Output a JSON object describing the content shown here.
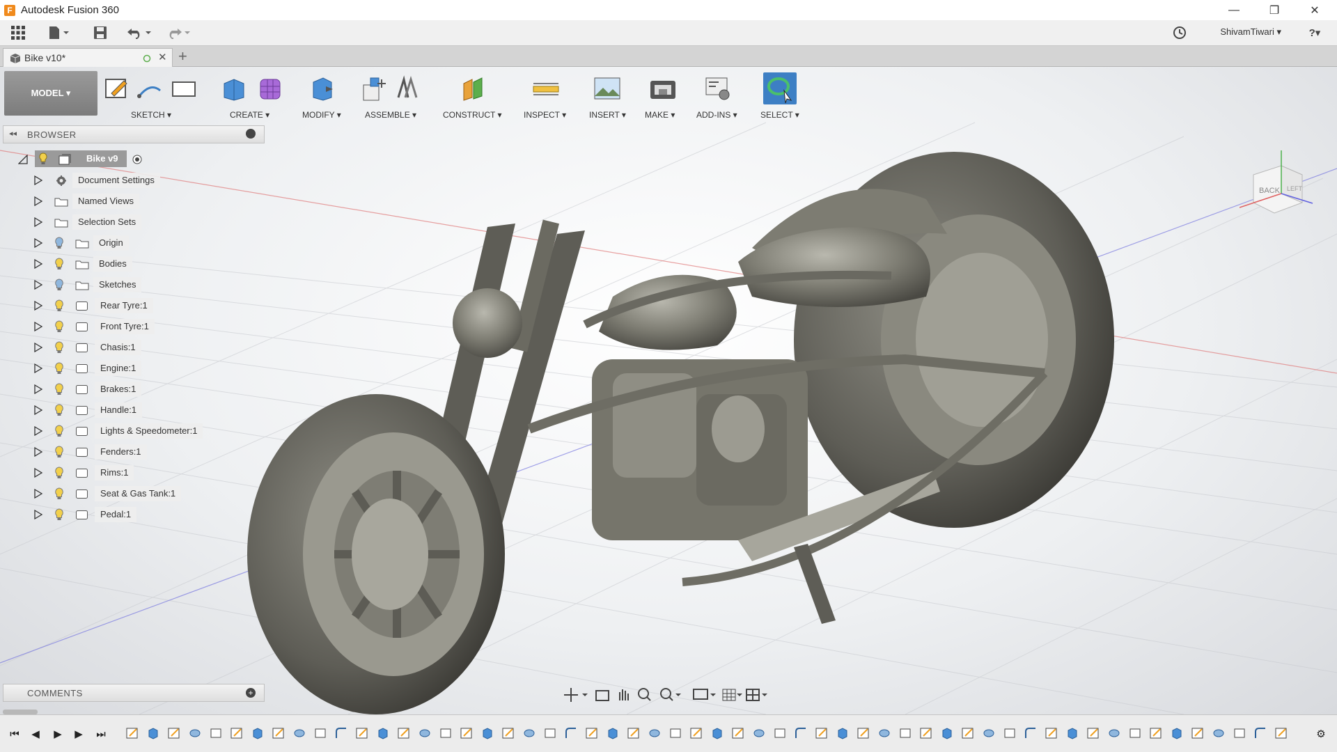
{
  "window": {
    "title": "Autodesk Fusion 360",
    "app_icon": "F",
    "minimize": "—",
    "restore": "❐",
    "close": "✕"
  },
  "quickaccess": {
    "user": "ShivamTiwari ▾",
    "help": "?▾"
  },
  "tab": {
    "title": "Bike v10*",
    "add": "+"
  },
  "toolbar": {
    "model": "MODEL ▾",
    "groups": [
      {
        "label": "SKETCH ▾"
      },
      {
        "label": "CREATE ▾"
      },
      {
        "label": "MODIFY ▾"
      },
      {
        "label": "ASSEMBLE ▾"
      },
      {
        "label": "CONSTRUCT ▾"
      },
      {
        "label": "INSPECT ▾"
      },
      {
        "label": "INSERT ▾"
      },
      {
        "label": "MAKE ▾"
      },
      {
        "label": "ADD-INS ▾"
      },
      {
        "label": "SELECT ▾"
      }
    ]
  },
  "browser": {
    "title": "BROWSER",
    "root": "Bike v9",
    "items": [
      {
        "label": "Document Settings",
        "icon": "gear-icon"
      },
      {
        "label": "Named Views",
        "icon": "folder-icon"
      },
      {
        "label": "Selection Sets",
        "icon": "folder-icon"
      },
      {
        "label": "Origin",
        "icon": "folder-icon"
      },
      {
        "label": "Bodies",
        "icon": "folder-icon"
      },
      {
        "label": "Sketches",
        "icon": "folder-icon"
      },
      {
        "label": "Rear Tyre:1",
        "icon": "component-icon"
      },
      {
        "label": "Front Tyre:1",
        "icon": "component-icon"
      },
      {
        "label": "Chasis:1",
        "icon": "component-icon"
      },
      {
        "label": "Engine:1",
        "icon": "component-icon"
      },
      {
        "label": "Brakes:1",
        "icon": "component-icon"
      },
      {
        "label": "Handle:1",
        "icon": "component-icon"
      },
      {
        "label": "Lights & Speedometer:1",
        "icon": "component-icon"
      },
      {
        "label": "Fenders:1",
        "icon": "component-icon"
      },
      {
        "label": "Rims:1",
        "icon": "component-icon"
      },
      {
        "label": "Seat & Gas Tank:1",
        "icon": "component-icon"
      },
      {
        "label": "Pedal:1",
        "icon": "component-icon"
      }
    ]
  },
  "comments": {
    "title": "COMMENTS"
  },
  "viewcube": {
    "back": "BACK",
    "left": "LEFT"
  },
  "colors": {
    "accent": "#3d7fc4",
    "bulb_on": "#f2d04b",
    "bulb_off": "#8fb7de",
    "model_gray": "#8a8a7e"
  }
}
